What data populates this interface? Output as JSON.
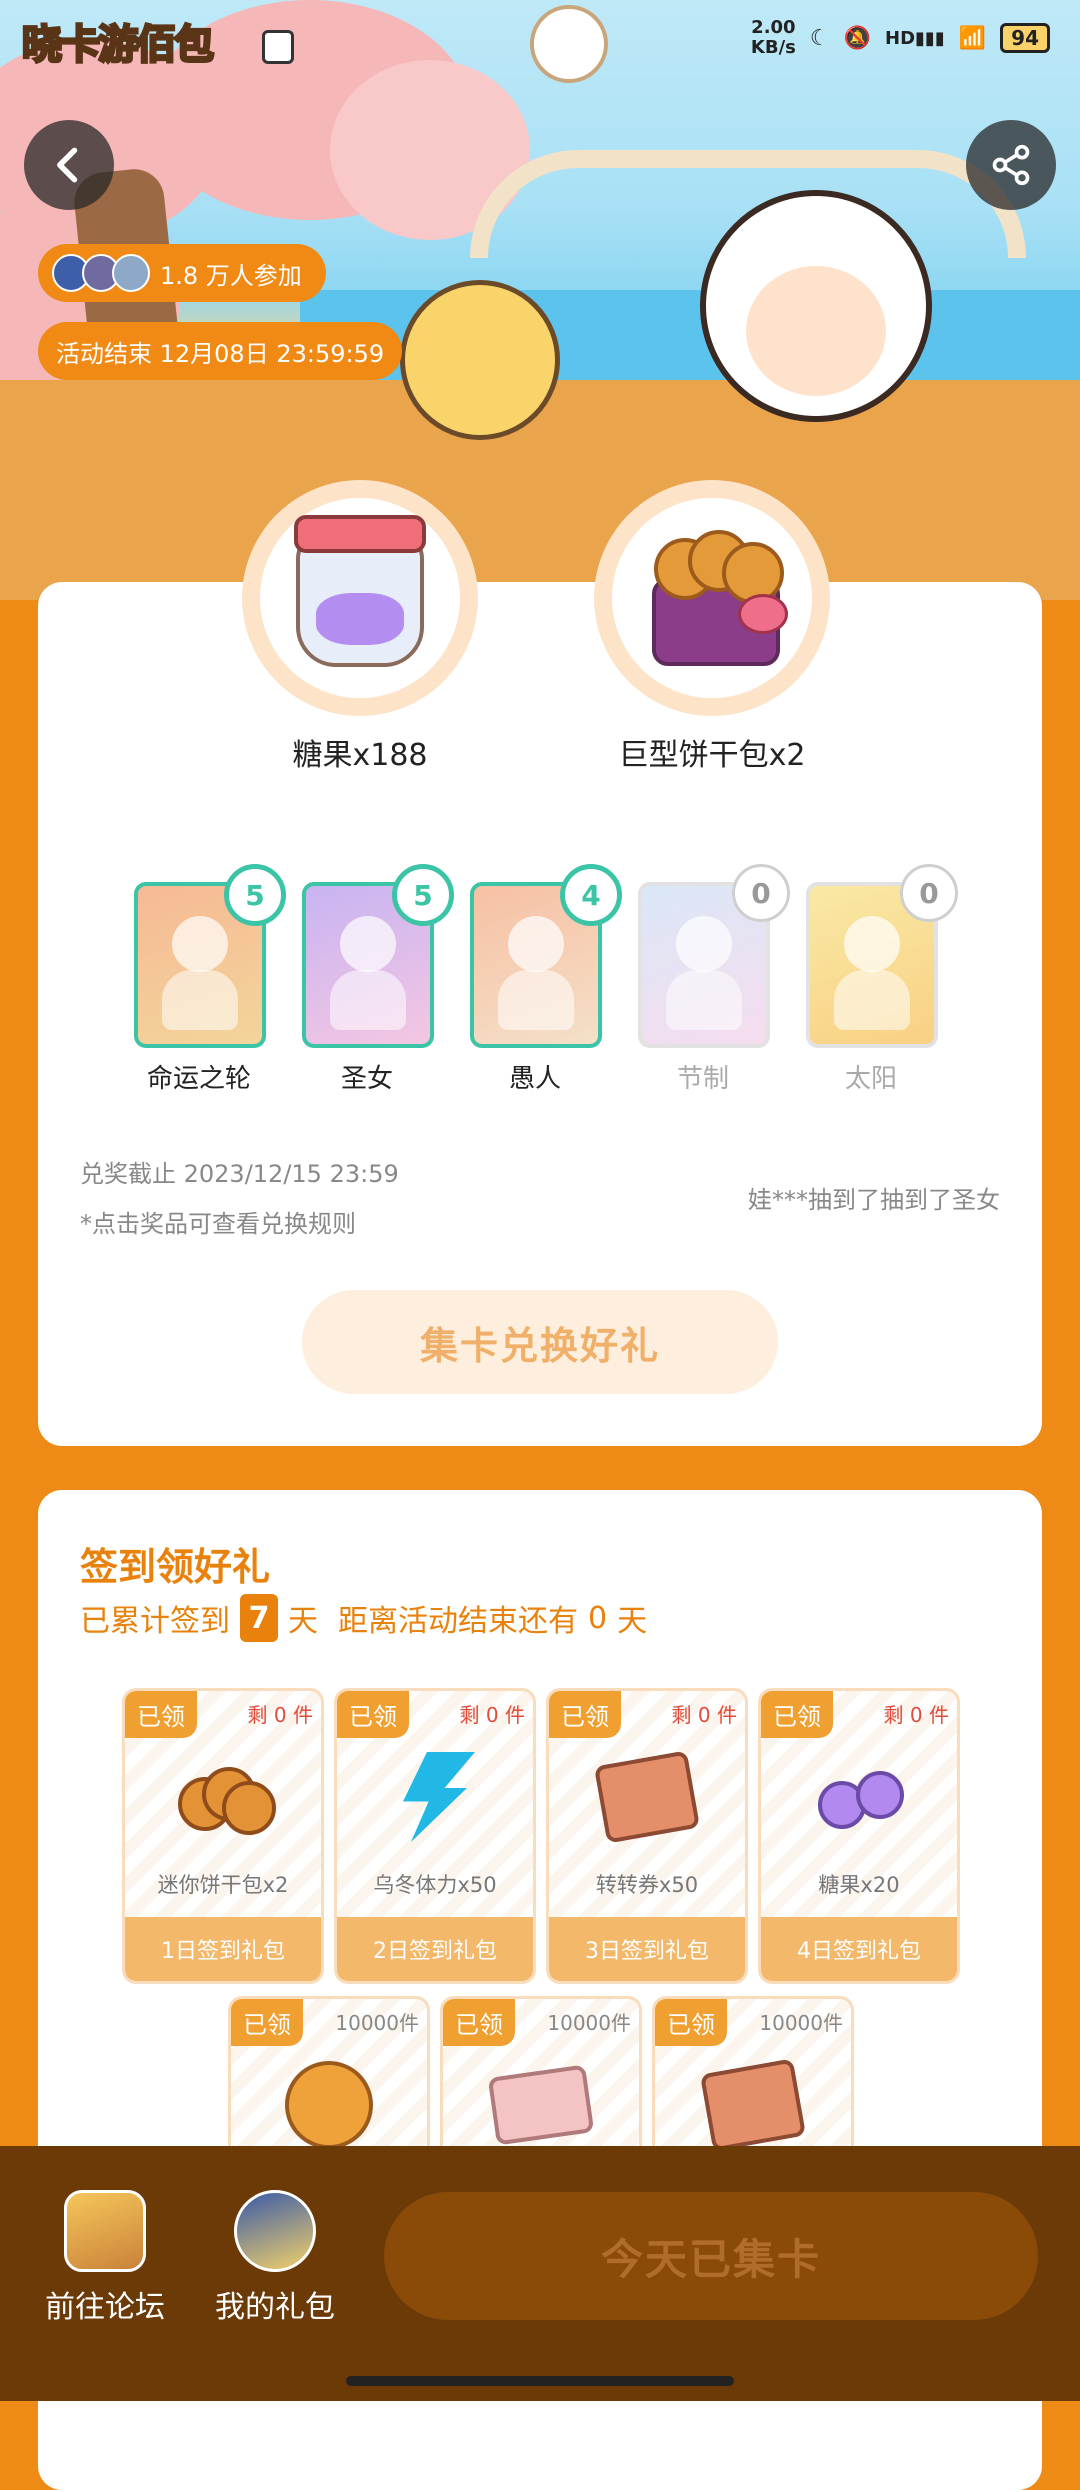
{
  "status_bar": {
    "speed": "2.00",
    "speed_unit": "KB/s",
    "battery": "94",
    "network": "HD"
  },
  "header": {
    "app_logo": "晓卡游佰包"
  },
  "activity": {
    "participants": "1.8 万人参加",
    "end_time": "活动结束 12月08日 23:59:59"
  },
  "prizes": [
    {
      "label": "糖果x188"
    },
    {
      "label": "巨型饼干包x2"
    }
  ],
  "cards": [
    {
      "name": "命运之轮",
      "count": "5",
      "owned": true
    },
    {
      "name": "圣女",
      "count": "5",
      "owned": true
    },
    {
      "name": "愚人",
      "count": "4",
      "owned": true
    },
    {
      "name": "节制",
      "count": "0",
      "owned": false
    },
    {
      "name": "太阳",
      "count": "0",
      "owned": false
    }
  ],
  "redeem": {
    "deadline": "兑奖截止 2023/12/15 23:59",
    "note": "*点击奖品可查看兑换规则",
    "ticker": "娃***抽到了抽到了圣女",
    "exchange_button": "集卡兑换好礼"
  },
  "signin": {
    "title": "签到领好礼",
    "sub_prefix": "已累计签到",
    "days": "7",
    "sub_suffix": "天",
    "remaining_prefix": "距离活动结束还有",
    "remaining_days": "0",
    "remaining_suffix": "天",
    "gifts": [
      {
        "tag": "已领",
        "left": "剩 0 件",
        "name": "迷你饼干包x2",
        "foot": "1日签到礼包",
        "icon": "cookies-icon"
      },
      {
        "tag": "已领",
        "left": "剩 0 件",
        "name": "乌冬体力x50",
        "foot": "2日签到礼包",
        "icon": "lightning-icon"
      },
      {
        "tag": "已领",
        "left": "剩 0 件",
        "name": "转转券x50",
        "foot": "3日签到礼包",
        "icon": "ticket-icon"
      },
      {
        "tag": "已领",
        "left": "剩 0 件",
        "name": "糖果x20",
        "foot": "4日签到礼包",
        "icon": "candy-icon"
      },
      {
        "tag": "已领",
        "left": "10000件",
        "icon": "cake-icon"
      },
      {
        "tag": "已领",
        "left": "10000件",
        "icon": "pink-ticket-icon"
      },
      {
        "tag": "已领",
        "left": "10000件",
        "icon": "ticket-stack-icon"
      }
    ]
  },
  "bottom_nav": {
    "forum": "前往论坛",
    "my_gifts": "我的礼包",
    "collect_button": "今天已集卡"
  },
  "colors": {
    "accent": "#ee8a16",
    "teal": "#3cc4a6",
    "bottom_bar": "#6b3a06"
  }
}
